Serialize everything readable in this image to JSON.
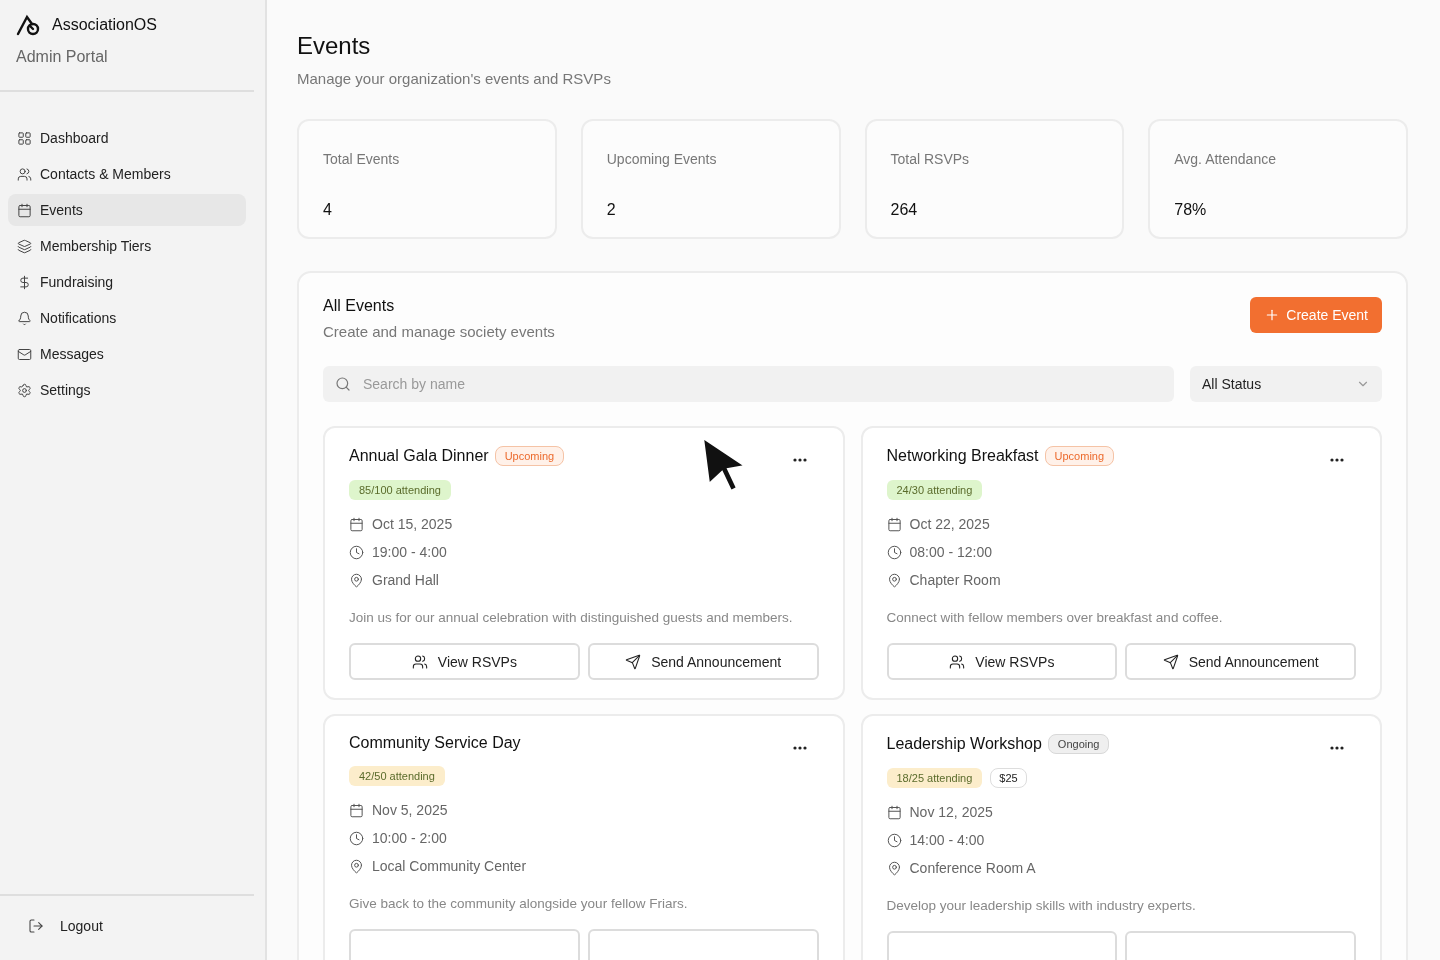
{
  "brand": {
    "name": "AssociationOS",
    "subtitle": "Admin Portal"
  },
  "nav": [
    {
      "label": "Dashboard",
      "selected": false
    },
    {
      "label": "Contacts & Members",
      "selected": false
    },
    {
      "label": "Events",
      "selected": true
    },
    {
      "label": "Membership Tiers",
      "selected": false
    },
    {
      "label": "Fundraising",
      "selected": false
    },
    {
      "label": "Notifications",
      "selected": false
    },
    {
      "label": "Messages",
      "selected": false
    },
    {
      "label": "Settings",
      "selected": false
    }
  ],
  "logout": "Logout",
  "page": {
    "title": "Events",
    "subtitle": "Manage your organization's events and RSVPs"
  },
  "stats": [
    {
      "label": "Total Events",
      "value": "4"
    },
    {
      "label": "Upcoming Events",
      "value": "2"
    },
    {
      "label": "Total RSVPs",
      "value": "264"
    },
    {
      "label": "Avg. Attendance",
      "value": "78%"
    }
  ],
  "panel": {
    "title": "All Events",
    "subtitle": "Create and manage society events",
    "create_button": "Create Event",
    "search": {
      "placeholder": "Search by name"
    },
    "status_filter": "All Status"
  },
  "events": [
    {
      "title": "Annual Gala Dinner",
      "status": {
        "kind": "upcoming",
        "label": "Upcoming"
      },
      "attendance": {
        "text": "85/100 attending",
        "color": "#def5cc"
      },
      "date": "Oct 15, 2025",
      "time": "19:00 - 4:00",
      "place": "Grand Hall",
      "description": "Join us for our annual celebration with distinguished guests and members.",
      "actions": [
        {
          "kind": "rsvps",
          "label": "View RSVPs"
        },
        {
          "kind": "announce",
          "label": "Send Announcement"
        }
      ]
    },
    {
      "title": "Networking Breakfast",
      "status": {
        "kind": "upcoming",
        "label": "Upcoming"
      },
      "attendance": {
        "text": "24/30 attending",
        "color": "#def5cc"
      },
      "date": "Oct 22, 2025",
      "time": "08:00 - 12:00",
      "place": "Chapter Room",
      "description": "Connect with fellow members over breakfast and coffee.",
      "actions": [
        {
          "kind": "rsvps",
          "label": "View RSVPs"
        },
        {
          "kind": "announce",
          "label": "Send Announcement"
        }
      ]
    },
    {
      "title": "Community Service Day",
      "attendance": {
        "text": "42/50 attending",
        "color": "#fcedcb"
      },
      "date": "Nov 5, 2025",
      "time": "10:00 - 2:00",
      "place": "Local Community Center",
      "description": "Give back to the community alongside your fellow Friars.",
      "actions": [
        {
          "kind": "rsvps"
        },
        {
          "kind": "announce"
        }
      ]
    },
    {
      "title": "Leadership Workshop",
      "status": {
        "kind": "ongoing",
        "label": "Ongoing"
      },
      "attendance": {
        "text": "18/25 attending",
        "color": "#fcedcb"
      },
      "price": "$25",
      "date": "Nov 12, 2025",
      "time": "14:00 - 4:00",
      "place": "Conference Room A",
      "description": "Develop your leadership skills with industry experts.",
      "actions": [
        {
          "kind": "rsvps"
        },
        {
          "kind": "announce"
        }
      ]
    }
  ]
}
